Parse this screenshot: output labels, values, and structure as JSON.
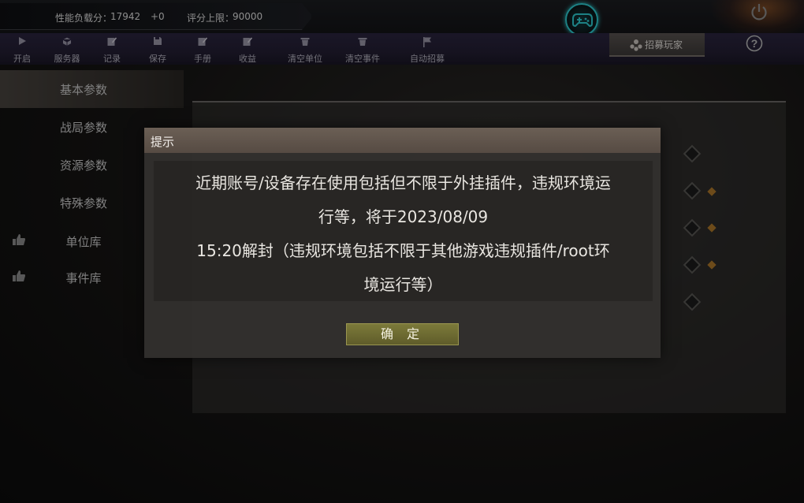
{
  "stats": {
    "load_label": "性能负载分：",
    "load_value": "17942",
    "delta": "+0",
    "limit_label": "评分上限：",
    "limit_value": "90000"
  },
  "toolbar": {
    "items": [
      {
        "label": "开启",
        "icon": "play-icon"
      },
      {
        "label": "服务器",
        "icon": "cube-icon"
      },
      {
        "label": "记录",
        "icon": "edit-icon"
      },
      {
        "label": "保存",
        "icon": "save-icon"
      },
      {
        "label": "手册",
        "icon": "edit-icon"
      },
      {
        "label": "收益",
        "icon": "edit-icon"
      },
      {
        "label": "清空单位",
        "icon": "trash-icon"
      },
      {
        "label": "清空事件",
        "icon": "trash-icon"
      },
      {
        "label": "自动招募",
        "icon": "flag-icon"
      }
    ],
    "recruit_label": "招募玩家"
  },
  "sidebar": {
    "items": [
      {
        "label": "基本参数"
      },
      {
        "label": "战局参数"
      },
      {
        "label": "资源参数"
      },
      {
        "label": "特殊参数"
      },
      {
        "label": "单位库"
      },
      {
        "label": "事件库"
      }
    ]
  },
  "dialog": {
    "title": "提示",
    "lines": [
      "近期账号/设备存在使用包括但不限于外挂插件，违规环境运",
      "行等，将于2023/08/09",
      "15:20解封（违规环境包括不限于其他游戏违规插件/root环",
      "境运行等）"
    ],
    "confirm_label": "确 定"
  },
  "colors": {
    "accent_cyan": "#2fd0d6",
    "confirm_button": "#6e6b32",
    "toolbar_bg": "#2b2540",
    "gem": "#b07a2a"
  }
}
